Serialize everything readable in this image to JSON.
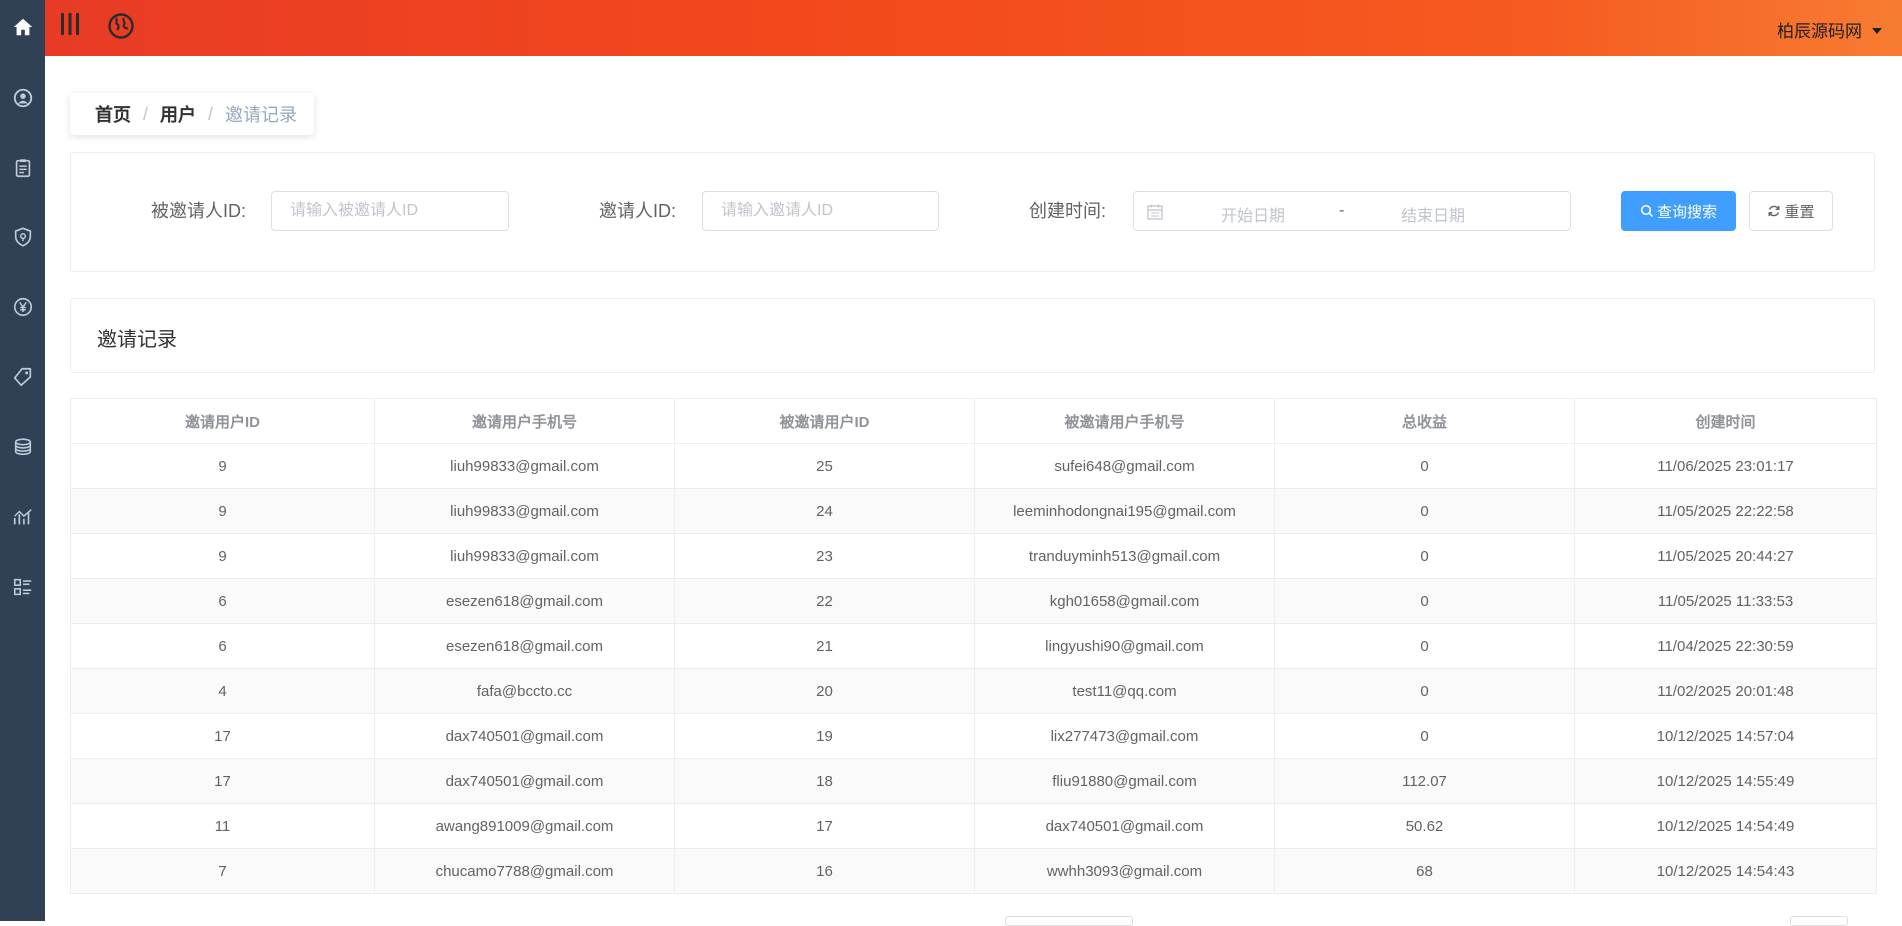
{
  "topbar": {
    "user_name": "柏辰源码网",
    "icons": [
      "menu-icon",
      "globe-icon",
      "caret-down-icon"
    ]
  },
  "sidebar": {
    "items": [
      "home-icon",
      "user-circle-icon",
      "clipboard-icon",
      "shield-icon",
      "yen-icon",
      "tag-icon",
      "coins-icon",
      "chart-icon",
      "list-icon"
    ]
  },
  "breadcrumb": {
    "home": "首页",
    "sep1": "/",
    "user": "用户",
    "sep2": "/",
    "current": "邀请记录"
  },
  "search": {
    "invitee_label": "被邀请人ID:",
    "invitee_placeholder": "请输入被邀请人ID",
    "inviter_label": "邀请人ID:",
    "inviter_placeholder": "请输入邀请人ID",
    "created_label": "创建时间:",
    "start_placeholder": "开始日期",
    "range_sep": "-",
    "end_placeholder": "结束日期",
    "search_button": "查询搜索",
    "reset_button": "重置"
  },
  "card": {
    "title": "邀请记录"
  },
  "table": {
    "columns": [
      "邀请用户ID",
      "邀请用户手机号",
      "被邀请用户ID",
      "被邀请用户手机号",
      "总收益",
      "创建时间"
    ],
    "rows": [
      [
        "9",
        "liuh99833@gmail.com",
        "25",
        "sufei648@gmail.com",
        "0",
        "11/06/2025 23:01:17"
      ],
      [
        "9",
        "liuh99833@gmail.com",
        "24",
        "leeminhodongnai195@gmail.com",
        "0",
        "11/05/2025 22:22:58"
      ],
      [
        "9",
        "liuh99833@gmail.com",
        "23",
        "tranduyminh513@gmail.com",
        "0",
        "11/05/2025 20:44:27"
      ],
      [
        "6",
        "esezen618@gmail.com",
        "22",
        "kgh01658@gmail.com",
        "0",
        "11/05/2025 11:33:53"
      ],
      [
        "6",
        "esezen618@gmail.com",
        "21",
        "lingyushi90@gmail.com",
        "0",
        "11/04/2025 22:30:59"
      ],
      [
        "4",
        "fafa@bccto.cc",
        "20",
        "test11@qq.com",
        "0",
        "11/02/2025 20:01:48"
      ],
      [
        "17",
        "dax740501@gmail.com",
        "19",
        "lix277473@gmail.com",
        "0",
        "10/12/2025 14:57:04"
      ],
      [
        "17",
        "dax740501@gmail.com",
        "18",
        "fliu91880@gmail.com",
        "112.07",
        "10/12/2025 14:55:49"
      ],
      [
        "11",
        "awang891009@gmail.com",
        "17",
        "dax740501@gmail.com",
        "50.62",
        "10/12/2025 14:54:49"
      ],
      [
        "7",
        "chucamo7788@gmail.com",
        "16",
        "wwhh3093@gmail.com",
        "68",
        "10/12/2025 14:54:43"
      ]
    ]
  },
  "colors": {
    "sidebar_bg": "#304156",
    "topbar_gradient_start": "#e83b26",
    "topbar_gradient_end": "#f77c32",
    "primary": "#409eff"
  }
}
